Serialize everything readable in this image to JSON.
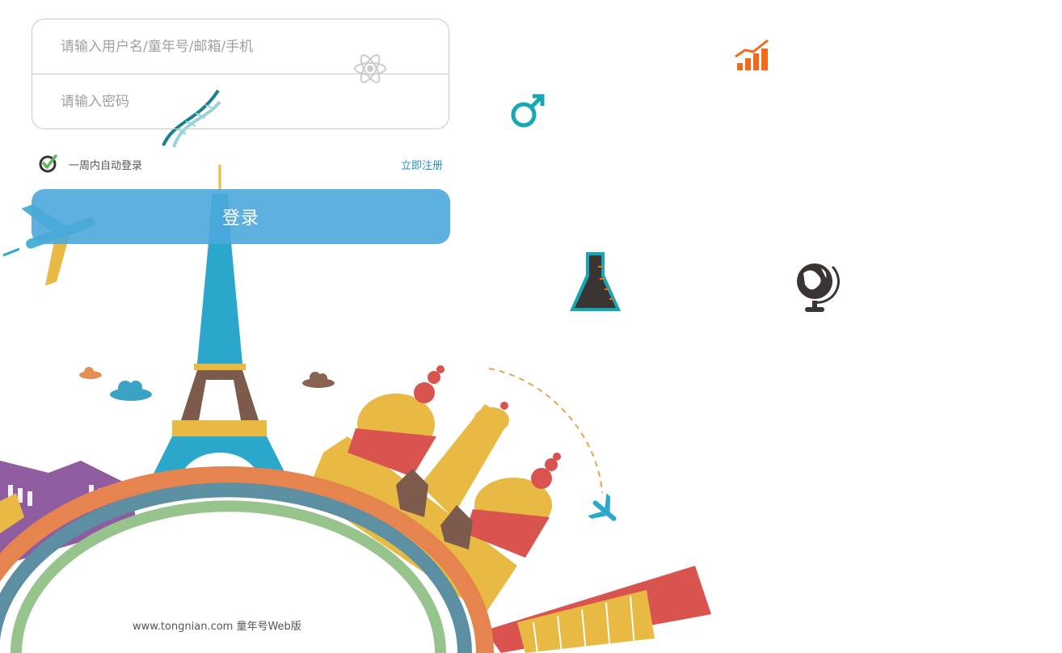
{
  "login": {
    "username_placeholder": "请输入用户名/童年号/邮箱/手机",
    "password_placeholder": "请输入密码",
    "remember_label": "一周内自动登录",
    "remember_checked": true,
    "register_link": "立即注册",
    "submit_label": "登录"
  },
  "footer": {
    "text": "www.tongnian.com 童年号Web版"
  },
  "icons": [
    "dna-icon",
    "atom-icon",
    "bar-chart-growth-icon",
    "male-symbol-icon",
    "flask-icon",
    "globe-icon",
    "airplane-icon"
  ],
  "colors": {
    "button": "#4ca9dc",
    "link": "#2a8fbe",
    "chart_icon": "#f36a1c",
    "male_icon": "#17a7b3"
  }
}
